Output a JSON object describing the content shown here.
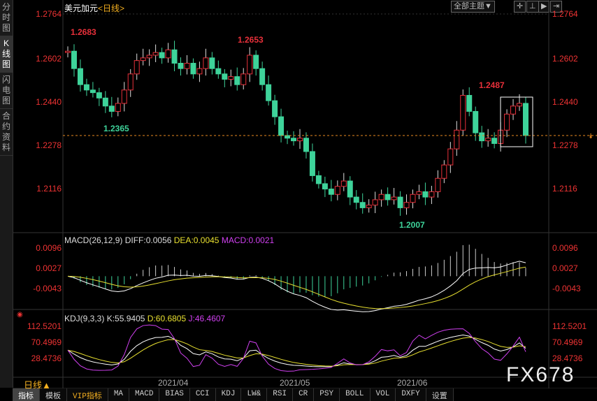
{
  "sidebar": [
    "分时图",
    "K线图",
    "闪电图",
    "合约资料"
  ],
  "header": {
    "symbol": "美元加元",
    "period": "<日线>",
    "theme_btn": "全部主题▼"
  },
  "price_axis": [
    "1.2764",
    "1.2602",
    "1.2440",
    "1.2278",
    "1.2116"
  ],
  "annotations": {
    "high1": "1.2683",
    "high2": "1.2653",
    "low1": "1.2365",
    "low2": "1.2007",
    "high3": "1.2487"
  },
  "macd": {
    "title": "MACD(26,12,9)",
    "diff": "DIFF:0.0056",
    "dea": "DEA:0.0045",
    "macd": "MACD:0.0021",
    "axis": [
      "0.0096",
      "0.0027",
      "-0.0043"
    ]
  },
  "kdj": {
    "title": "KDJ(9,3,3)",
    "k": "K:55.9405",
    "d": "D:60.6805",
    "j": "J:46.4607",
    "axis": [
      "112.5201",
      "70.4969",
      "28.4736"
    ]
  },
  "dates": [
    "2021/04",
    "2021/05",
    "2021/06"
  ],
  "period_label": "日线▲",
  "tabs": [
    "指标",
    "模板",
    "VIP指标",
    "MA",
    "MACD",
    "BIAS",
    "CCI",
    "KDJ",
    "LW&",
    "RSI",
    "CR",
    "PSY",
    "BOLL",
    "VOL",
    "DXFY",
    "设置"
  ],
  "watermark": "FX678",
  "colors": {
    "up": "#e8303a",
    "down": "#3ed39a",
    "dash": "#e88a20"
  },
  "chart_data": {
    "type": "candlestick",
    "ylim": [
      1.1954,
      1.2764
    ],
    "first_open": 1.262,
    "closes": [
      1.2625,
      1.256,
      1.25,
      1.248,
      1.247,
      1.245,
      1.242,
      1.24,
      1.243,
      1.248,
      1.254,
      1.259,
      1.26,
      1.261,
      1.262,
      1.26,
      1.263,
      1.258,
      1.256,
      1.258,
      1.254,
      1.256,
      1.26,
      1.256,
      1.254,
      1.252,
      1.253,
      1.25,
      1.254,
      1.261,
      1.256,
      1.25,
      1.244,
      1.238,
      1.231,
      1.23,
      1.229,
      1.23,
      1.225,
      1.216,
      1.213,
      1.211,
      1.209,
      1.212,
      1.214,
      1.208,
      1.206,
      1.204,
      1.205,
      1.207,
      1.209,
      1.207,
      1.208,
      1.204,
      1.206,
      1.209,
      1.21,
      1.208,
      1.21,
      1.215,
      1.22,
      1.226,
      1.233,
      1.246,
      1.24,
      1.232,
      1.229,
      1.23,
      1.228,
      1.233,
      1.239,
      1.242,
      1.243,
      1.231
    ]
  }
}
